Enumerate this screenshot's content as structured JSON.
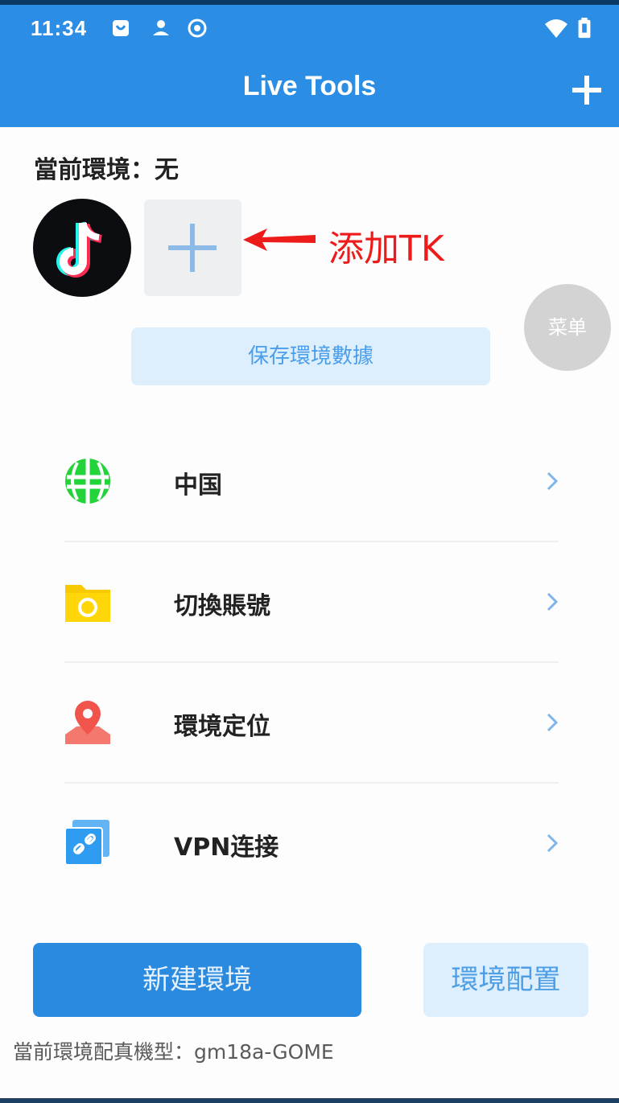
{
  "status_bar": {
    "time": "11:34",
    "icons": [
      "notification-icon",
      "game-icon",
      "record-icon",
      "wifi-icon",
      "battery-icon"
    ]
  },
  "app_bar": {
    "title": "Live Tools",
    "add_icon": "plus-icon"
  },
  "current_env": {
    "label": "當前環境：无"
  },
  "apps": {
    "tiktok_icon": "tiktok-icon",
    "add_icon": "plus-icon"
  },
  "annotation": {
    "text": "添加TK",
    "color": "#ee1b1b"
  },
  "menu_fab": {
    "label": "菜单"
  },
  "save_button": {
    "label": "保存環境數據"
  },
  "list": [
    {
      "label": "中国",
      "icon": "globe-icon"
    },
    {
      "label": "切換賬號",
      "icon": "folder-icon"
    },
    {
      "label": "環境定位",
      "icon": "location-pin-icon"
    },
    {
      "label": "VPN连接",
      "icon": "link-icon"
    }
  ],
  "buttons": {
    "new_env": "新建環境",
    "env_config": "環境配置"
  },
  "footer": {
    "text": "當前環境配真機型：gm18a-GOME"
  },
  "colors": {
    "primary": "#2b8de3",
    "light_button": "#ddeefd",
    "annotation": "#ee1b1b"
  }
}
